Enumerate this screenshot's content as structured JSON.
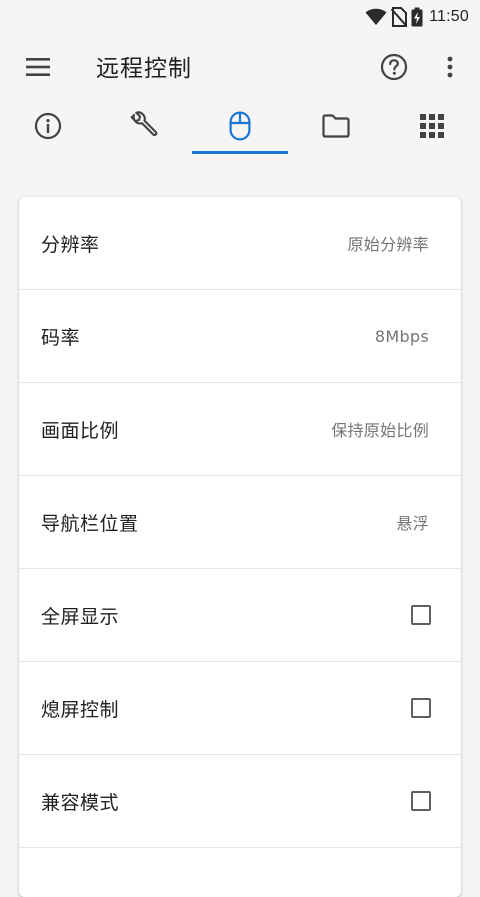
{
  "status_bar": {
    "time": "11:50",
    "icons": [
      "wifi-icon",
      "no-sim-icon",
      "battery-charging-icon"
    ]
  },
  "app_bar": {
    "title": "远程控制",
    "icons": [
      "menu-icon",
      "help-icon",
      "more-vert-icon"
    ]
  },
  "tabs": [
    {
      "icon": "info-icon",
      "selected": false
    },
    {
      "icon": "wrench-icon",
      "selected": false
    },
    {
      "icon": "mouse-icon",
      "selected": true
    },
    {
      "icon": "folder-icon",
      "selected": false
    },
    {
      "icon": "apps-grid-icon",
      "selected": false
    }
  ],
  "colors": {
    "accent": "#1976d2",
    "background": "#f5f5f5",
    "card": "#ffffff",
    "secondary_text": "#757575"
  },
  "settings": [
    {
      "label": "分辨率",
      "value": "原始分辨率"
    },
    {
      "label": "码率",
      "value": "8Mbps"
    },
    {
      "label": "画面比例",
      "value": "保持原始比例"
    },
    {
      "label": "导航栏位置",
      "value": "悬浮"
    },
    {
      "label": "全屏显示",
      "checked": false
    },
    {
      "label": "熄屏控制",
      "checked": false
    },
    {
      "label": "兼容模式",
      "checked": false
    }
  ]
}
